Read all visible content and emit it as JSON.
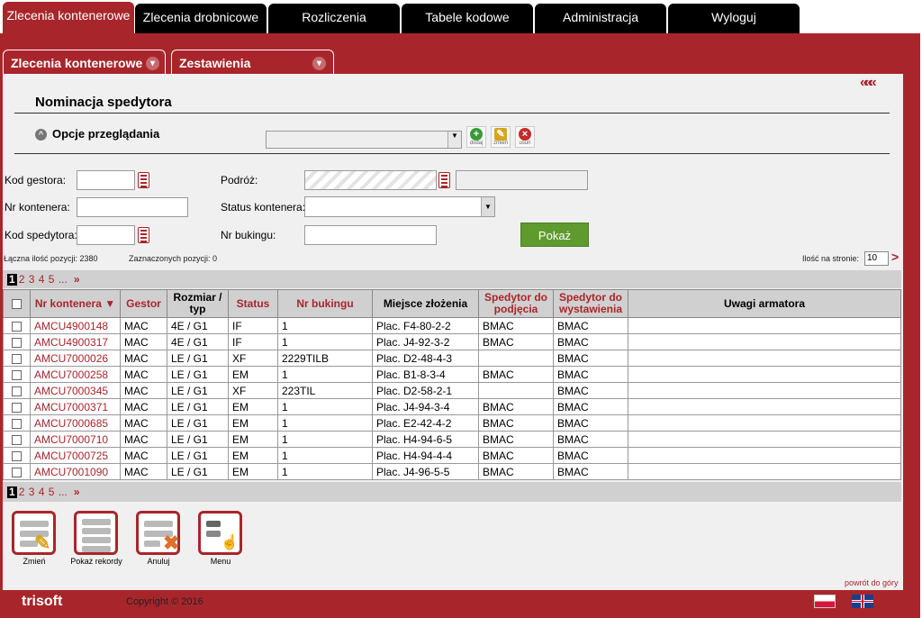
{
  "topnav": [
    "Zlecenia kontenerowe",
    "Zlecenia drobnicowe",
    "Rozliczenia",
    "Tabele kodowe",
    "Administracja",
    "Wyloguj"
  ],
  "subnav": [
    "Zlecenia kontenerowe",
    "Zestawienia"
  ],
  "page": {
    "title": "Nominacja spedytora",
    "options_label": "Opcje przeglądania",
    "back": "«««"
  },
  "toolbar": {
    "add": "dodaj",
    "edit": "zmień",
    "delete": "usuń"
  },
  "filters": {
    "kod_gestora": "Kod gestora:",
    "nr_kontenera": "Nr kontenera:",
    "kod_spedytora": "Kod spedytora:",
    "podroz": "Podróż:",
    "status_kontenera": "Status kontenera:",
    "nr_bukingu": "Nr bukingu:"
  },
  "buttons": {
    "pokaz": "Pokaż"
  },
  "summary": {
    "total": "Łączna ilość pozycji: 2380",
    "selected": "Zaznaczonych pozycji: 0",
    "per_page_label": "Ilość na stronie:",
    "per_page": "10"
  },
  "pager": {
    "current": "1",
    "pages": [
      "2",
      "3",
      "4",
      "5",
      "..."
    ],
    "next": "»"
  },
  "columns": [
    "Nr kontenera",
    "Gestor",
    "Rozmiar / typ",
    "Status",
    "Nr bukingu",
    "Miejsce złożenia",
    "Spedytor do podjęcia",
    "Spedytor do wystawienia",
    "Uwagi armatora"
  ],
  "rows": [
    [
      "AMCU4900148",
      "MAC",
      "4E / G1",
      "IF",
      "1",
      "Plac. F4-80-2-2",
      "BMAC",
      "BMAC",
      ""
    ],
    [
      "AMCU4900317",
      "MAC",
      "4E / G1",
      "IF",
      "1",
      "Plac. J4-92-3-2",
      "BMAC",
      "BMAC",
      ""
    ],
    [
      "AMCU7000026",
      "MAC",
      "LE / G1",
      "XF",
      "2229TILB",
      "Plac. D2-48-4-3",
      "",
      "BMAC",
      ""
    ],
    [
      "AMCU7000258",
      "MAC",
      "LE / G1",
      "EM",
      "1",
      "Plac. B1-8-3-4",
      "BMAC",
      "BMAC",
      ""
    ],
    [
      "AMCU7000345",
      "MAC",
      "LE / G1",
      "XF",
      "223TIL",
      "Plac. D2-58-2-1",
      "",
      "BMAC",
      ""
    ],
    [
      "AMCU7000371",
      "MAC",
      "LE / G1",
      "EM",
      "1",
      "Plac. J4-94-3-4",
      "BMAC",
      "BMAC",
      ""
    ],
    [
      "AMCU7000685",
      "MAC",
      "LE / G1",
      "EM",
      "1",
      "Plac. E2-42-4-2",
      "BMAC",
      "BMAC",
      ""
    ],
    [
      "AMCU7000710",
      "MAC",
      "LE / G1",
      "EM",
      "1",
      "Plac. H4-94-6-5",
      "BMAC",
      "BMAC",
      ""
    ],
    [
      "AMCU7000725",
      "MAC",
      "LE / G1",
      "EM",
      "1",
      "Plac. H4-94-4-4",
      "BMAC",
      "BMAC",
      ""
    ],
    [
      "AMCU7001090",
      "MAC",
      "LE / G1",
      "EM",
      "1",
      "Plac. J4-96-5-5",
      "BMAC",
      "BMAC",
      ""
    ]
  ],
  "actions": [
    "Zmień",
    "Pokaż rekordy",
    "Anuluj",
    "Menu"
  ],
  "footer": {
    "logo": "trisoft",
    "copyright": "Copyright © 2016",
    "back_to_top": "powrót do góry"
  },
  "colors": {
    "brand": "#a8262b",
    "ok": "#5f9a2e"
  }
}
